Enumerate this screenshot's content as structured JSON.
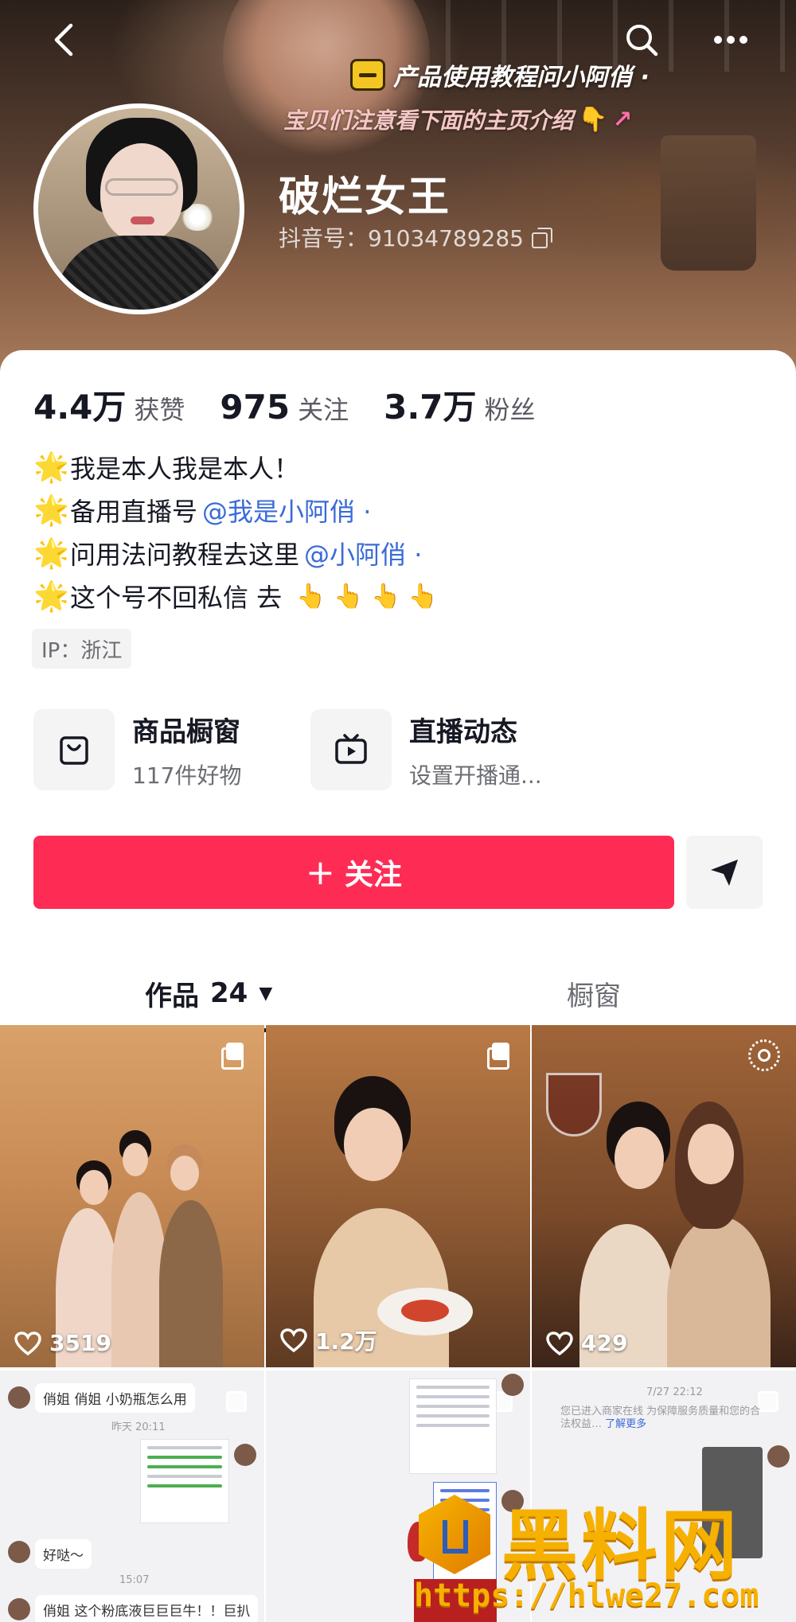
{
  "header": {
    "overlay_line1": "产品使用教程问小阿俏 ·",
    "overlay_line2": "宝贝们注意看下面的主页介绍",
    "overlay_emoji": "👇",
    "overlay_arrow": "↗"
  },
  "profile": {
    "nickname": "破烂女王",
    "douyin_id": "抖音号：91034789285",
    "stats": [
      {
        "value": "4.4万",
        "label": "获赞"
      },
      {
        "value": "975",
        "label": "关注"
      },
      {
        "value": "3.7万",
        "label": "粉丝"
      }
    ],
    "bio": [
      {
        "icon": "🌟",
        "text": "我是本人我是本人！",
        "mention": ""
      },
      {
        "icon": "🌟",
        "text": "备用直播号",
        "mention": "@我是小阿俏 ·"
      },
      {
        "icon": "🌟",
        "text": "问用法问教程去这里",
        "mention": "@小阿俏 ·"
      },
      {
        "icon": "🌟",
        "text": "这个号不回私信 去",
        "mention": ""
      }
    ],
    "bio_hands": "👆 👆 👆 👆",
    "ip": "IP：浙江"
  },
  "features": {
    "shop": {
      "title": "商品橱窗",
      "subtitle": "117件好物"
    },
    "live": {
      "title": "直播动态",
      "subtitle": "设置开播通..."
    }
  },
  "actions": {
    "follow_plus": "+",
    "follow_label": "关注"
  },
  "tabs": {
    "works_label": "作品",
    "works_count": "24",
    "works_caret": "▼",
    "window_label": "橱窗"
  },
  "posts": [
    {
      "likes": "3519"
    },
    {
      "likes": "1.2万"
    },
    {
      "likes": "429"
    }
  ],
  "chat_tiles": {
    "tile1_msg1": "俏姐 俏姐 小奶瓶怎么用",
    "tile1_time1": "昨天 20:11",
    "tile1_msg2": "好哒～",
    "tile1_time2": "15:07",
    "tile1_msg3": "俏姐 这个粉底液巨巨巨牛！！巨扒",
    "tile3_time": "7/27 22:12",
    "tile3_notice": "您已进入商家在线 为保障服务质量和您的合法权益…",
    "tile3_link": "了解更多"
  },
  "watermark": {
    "text": "黑料网",
    "url": "https://hlwe27.com"
  },
  "colors": {
    "accent": "#fe2c55",
    "mention": "#3a6bd8",
    "watermark": "#f6b100"
  }
}
